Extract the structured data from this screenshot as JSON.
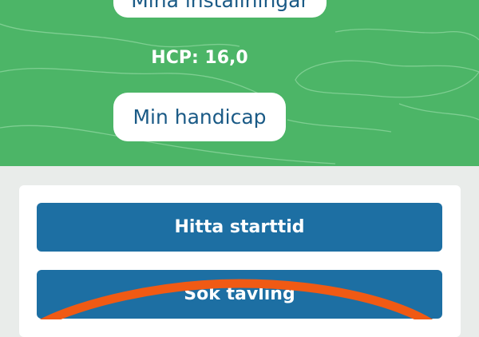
{
  "header": {
    "settings_label": "Mina inställningar",
    "hcp_text": "HCP: 16,0",
    "handicap_label": "Min handicap"
  },
  "actions": {
    "find_tee_time_label": "Hitta starttid",
    "search_competition_label": "Sök tävling"
  },
  "colors": {
    "hero_green": "#4cb567",
    "button_blue": "#1d6fa3",
    "annotation_orange": "#f05a14"
  }
}
